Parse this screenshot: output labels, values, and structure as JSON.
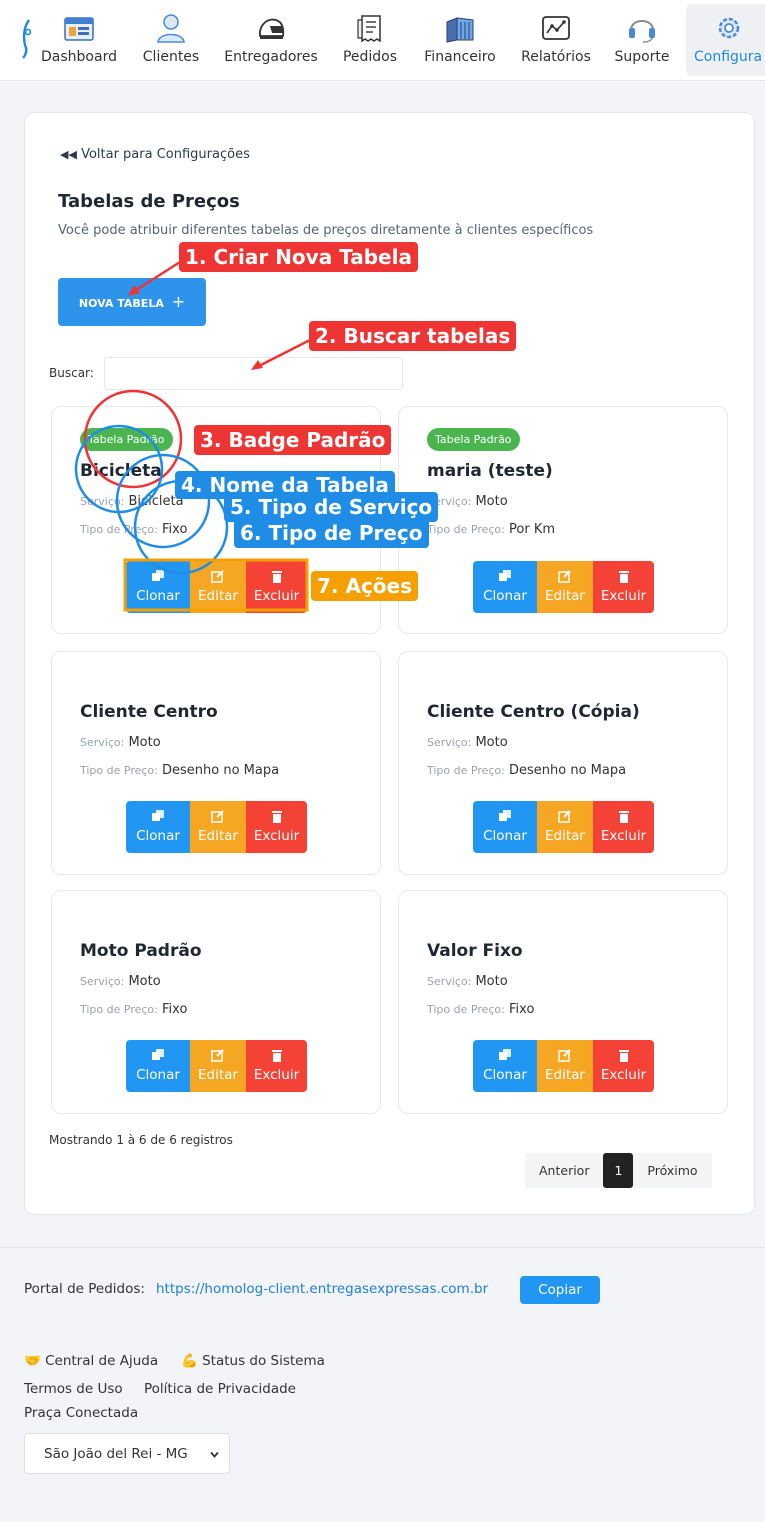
{
  "nav": {
    "items": [
      {
        "label": "Dashboard",
        "icon": "dashboard-icon"
      },
      {
        "label": "Clientes",
        "icon": "user-icon"
      },
      {
        "label": "Entregadores",
        "icon": "helmet-icon"
      },
      {
        "label": "Pedidos",
        "icon": "receipt-icon"
      },
      {
        "label": "Financeiro",
        "icon": "books-icon"
      },
      {
        "label": "Relatórios",
        "icon": "chart-icon"
      },
      {
        "label": "Suporte",
        "icon": "headset-icon"
      },
      {
        "label": "Configura",
        "icon": "gear-icon"
      }
    ]
  },
  "page": {
    "back_link": "Voltar para Configurações",
    "title": "Tabelas de Preços",
    "subtitle": "Você pode atribuir diferentes tabelas de preços diretamente à clientes específicos",
    "new_button": "NOVA TABELA",
    "search_label": "Buscar:",
    "search_value": ""
  },
  "labels": {
    "service": "Serviço:",
    "price_type": "Tipo de Preço:",
    "clone": "Clonar",
    "edit": "Editar",
    "delete": "Excluir"
  },
  "tables": [
    {
      "badge": "Tabela Padrão",
      "name": "Bicicleta",
      "service": "Bicicleta",
      "price_type": "Fixo"
    },
    {
      "badge": "Tabela Padrão",
      "name": "maria (teste)",
      "service": "Moto",
      "price_type": "Por Km"
    },
    {
      "badge": "",
      "name": "Cliente Centro",
      "service": "Moto",
      "price_type": "Desenho no Mapa"
    },
    {
      "badge": "",
      "name": "Cliente Centro (Cópia)",
      "service": "Moto",
      "price_type": "Desenho no Mapa"
    },
    {
      "badge": "",
      "name": "Moto Padrão",
      "service": "Moto",
      "price_type": "Fixo"
    },
    {
      "badge": "",
      "name": "Valor Fixo",
      "service": "Moto",
      "price_type": "Fixo"
    }
  ],
  "pagination": {
    "showing": "Mostrando 1 à 6 de 6 registros",
    "prev": "Anterior",
    "current": "1",
    "next": "Próximo"
  },
  "footer": {
    "portal_label": "Portal de Pedidos:",
    "portal_url": "https://homolog-client.entregasexpressas.com.br",
    "copy_button": "Copiar",
    "help_link": "🤝 Central de Ajuda",
    "status_link": "💪 Status do Sistema",
    "terms_link": "Termos de Uso",
    "privacy_link": "Política de Privacidade",
    "city_label": "Praça Conectada",
    "city_selected": "São João del Rei - MG"
  },
  "annotations": {
    "a1": "1. Criar Nova Tabela",
    "a2": "2. Buscar tabelas",
    "a3": "3. Badge Padrão",
    "a4": "4. Nome da Tabela",
    "a5": "5. Tipo de Serviço",
    "a6": "6. Tipo de Preço",
    "a7": "7. Ações"
  },
  "colors": {
    "primary": "#2196f3",
    "edit": "#f5a623",
    "delete": "#f44336",
    "badge": "#4ab54f",
    "annotation_red": "#ef3434",
    "annotation_blue": "#1f8de6",
    "annotation_orange": "#f5a000"
  }
}
